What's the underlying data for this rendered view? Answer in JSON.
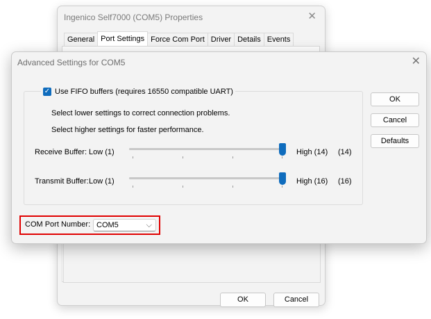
{
  "properties_window": {
    "title": "Ingenico Self7000 (COM5) Properties",
    "close_glyph": "✕",
    "tabs": [
      {
        "label": "General",
        "active": false
      },
      {
        "label": "Port Settings",
        "active": true
      },
      {
        "label": "Force Com Port",
        "active": false
      },
      {
        "label": "Driver",
        "active": false
      },
      {
        "label": "Details",
        "active": false
      },
      {
        "label": "Events",
        "active": false
      }
    ],
    "ok_label": "OK",
    "cancel_label": "Cancel"
  },
  "advanced_dialog": {
    "title": "Advanced Settings for COM5",
    "close_glyph": "✕",
    "fifo": {
      "label": "Use FIFO buffers (requires 16550 compatible UART)",
      "checked": true,
      "check_glyph": "✓"
    },
    "hint_lower": "Select lower settings to correct connection problems.",
    "hint_higher": "Select higher settings for faster performance.",
    "receive_buffer": {
      "label": "Receive Buffer:",
      "low": "Low (1)",
      "high": "High (14)",
      "value_text": "(14)",
      "level": 1.0
    },
    "transmit_buffer": {
      "label": "Transmit Buffer:",
      "low": "Low (1)",
      "high": "High (16)",
      "value_text": "(16)",
      "level": 1.0
    },
    "buttons": {
      "ok": "OK",
      "cancel": "Cancel",
      "defaults": "Defaults"
    },
    "com_port": {
      "label": "COM Port Number:",
      "value": "COM5",
      "chevron": "⌵"
    }
  },
  "colors": {
    "accent": "#0f6cbd",
    "highlight_border": "#e00000"
  }
}
